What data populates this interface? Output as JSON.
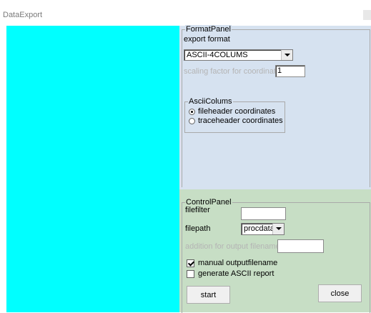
{
  "window": {
    "title": "DataExport"
  },
  "format_panel": {
    "group_title": "FormatPanel",
    "export_format_label": "export format",
    "export_format_value": "ASCII-4COLUMS",
    "scaling_label": "scaling factor for coordinates:",
    "scaling_value": "1",
    "ascii_columns": {
      "group_title": "AsciiColums",
      "options": [
        {
          "label": "fileheader coordinates",
          "selected": true
        },
        {
          "label": "traceheader coordinates",
          "selected": false
        }
      ]
    }
  },
  "control_panel": {
    "group_title": "ControlPanel",
    "filefilter_label": "filefilter",
    "filefilter_value": "",
    "filepath_label": "filepath",
    "filepath_value": "procdata",
    "addition_label": "addition for output filename:",
    "addition_value": "",
    "manual_output_label": "manual outputfilename",
    "manual_output_checked": true,
    "ascii_report_label": "generate ASCII report",
    "ascii_report_checked": false,
    "start_label": "start",
    "close_label": "close"
  },
  "colors": {
    "preview_area": "#00ffff",
    "format_panel_bg": "#d6e2f0",
    "control_panel_bg": "#c7dec5"
  }
}
